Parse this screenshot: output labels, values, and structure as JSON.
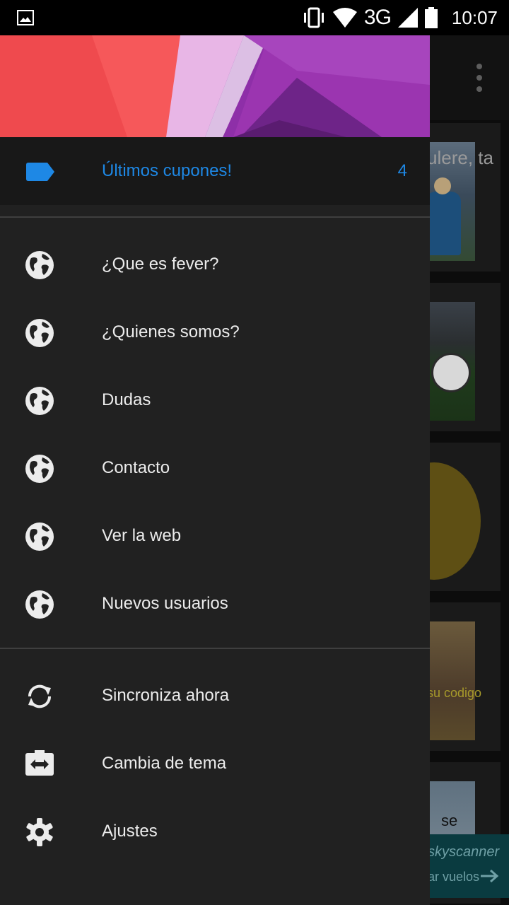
{
  "status_bar": {
    "network": "3G",
    "time": "10:07"
  },
  "drawer": {
    "selected_item": {
      "label": "Últimos cupones!",
      "count": "4",
      "icon": "label-tag-icon",
      "accent_color": "#1e88e5"
    },
    "web_items": [
      {
        "label": "¿Que es fever?",
        "icon": "globe-icon"
      },
      {
        "label": "¿Quienes somos?",
        "icon": "globe-icon"
      },
      {
        "label": "Dudas",
        "icon": "globe-icon"
      },
      {
        "label": "Contacto",
        "icon": "globe-icon"
      },
      {
        "label": "Ver la web",
        "icon": "globe-icon"
      },
      {
        "label": "Nuevos usuarios",
        "icon": "globe-icon"
      }
    ],
    "action_items": [
      {
        "label": "Sincroniza ahora",
        "icon": "sync-icon"
      },
      {
        "label": "Cambia de tema",
        "icon": "swap-theme-icon"
      },
      {
        "label": "Ajustes",
        "icon": "settings-gear-icon"
      }
    ]
  },
  "background_feed": {
    "card1_text": "ulere, ta",
    "card4_text": "su codigo",
    "card5_text": "se",
    "ad_banner": {
      "brand": "skyscanner",
      "cta": "ar vuelos"
    }
  }
}
